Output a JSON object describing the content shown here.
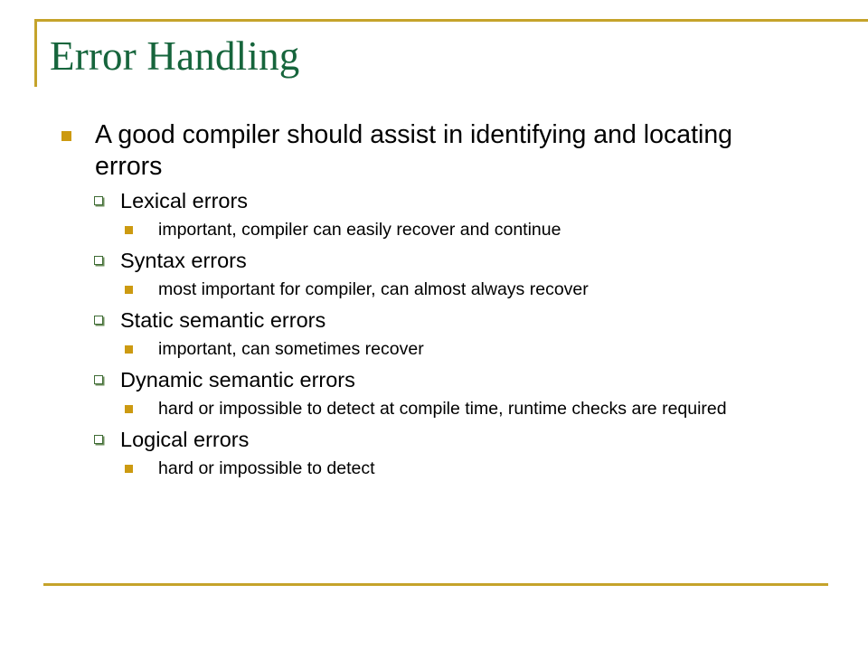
{
  "slide": {
    "title": "Error Handling",
    "theme": {
      "title_color": "#16653C",
      "rule_color": "#C5A32B",
      "bullet_level1_color": "#CC9A11",
      "bullet_level2_color": "#3E6B34",
      "bullet_level3_color": "#CC9A11",
      "body_text_color": "#000000",
      "background_color": "#FFFFFF"
    },
    "bullets": [
      {
        "level": 1,
        "text": "A good compiler should assist in identifying and locating errors",
        "bullet_icon": "filled-square-bullet-icon"
      },
      {
        "level": 2,
        "text": "Lexical errors",
        "bullet_icon": "hollow-square-bullet-icon"
      },
      {
        "level": 3,
        "text": "important, compiler can easily recover and continue",
        "bullet_icon": "small-filled-square-bullet-icon"
      },
      {
        "level": 2,
        "text": "Syntax errors",
        "bullet_icon": "hollow-square-bullet-icon"
      },
      {
        "level": 3,
        "text": "most important for compiler, can almost always recover",
        "bullet_icon": "small-filled-square-bullet-icon"
      },
      {
        "level": 2,
        "text": "Static semantic errors",
        "bullet_icon": "hollow-square-bullet-icon"
      },
      {
        "level": 3,
        "text": "important, can sometimes recover",
        "bullet_icon": "small-filled-square-bullet-icon"
      },
      {
        "level": 2,
        "text": "Dynamic semantic errors",
        "bullet_icon": "hollow-square-bullet-icon"
      },
      {
        "level": 3,
        "text": "hard or impossible to detect at compile time, runtime checks are required",
        "bullet_icon": "small-filled-square-bullet-icon"
      },
      {
        "level": 2,
        "text": "Logical errors",
        "bullet_icon": "hollow-square-bullet-icon"
      },
      {
        "level": 3,
        "text": "hard or impossible to detect",
        "bullet_icon": "small-filled-square-bullet-icon"
      }
    ]
  }
}
